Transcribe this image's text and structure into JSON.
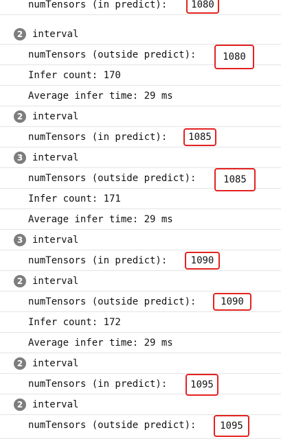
{
  "console": {
    "rows": [
      {
        "type": "msg",
        "prefix": "numTensors (in predict):",
        "value": "1080"
      },
      {
        "type": "group",
        "badge": "2",
        "text": "interval"
      },
      {
        "type": "msg",
        "prefix": "numTensors (outside predict):",
        "value": "1080"
      },
      {
        "type": "msg",
        "text": "Infer count: 170"
      },
      {
        "type": "msg",
        "text": "Average infer time: 29 ms"
      },
      {
        "type": "group",
        "badge": "2",
        "text": "interval"
      },
      {
        "type": "msg",
        "prefix": "numTensors (in predict):",
        "value": "1085"
      },
      {
        "type": "group",
        "badge": "3",
        "text": "interval"
      },
      {
        "type": "msg",
        "prefix": "numTensors (outside predict):",
        "value": "1085"
      },
      {
        "type": "msg",
        "text": "Infer count: 171"
      },
      {
        "type": "msg",
        "text": "Average infer time: 29 ms"
      },
      {
        "type": "group",
        "badge": "3",
        "text": "interval"
      },
      {
        "type": "msg",
        "prefix": "numTensors (in predict):",
        "value": "1090"
      },
      {
        "type": "group",
        "badge": "2",
        "text": "interval"
      },
      {
        "type": "msg",
        "prefix": "numTensors (outside predict):",
        "value": "1090"
      },
      {
        "type": "msg",
        "text": "Infer count: 172"
      },
      {
        "type": "msg",
        "text": "Average infer time: 29 ms"
      },
      {
        "type": "group",
        "badge": "2",
        "text": "interval"
      },
      {
        "type": "msg",
        "prefix": "numTensors (in predict):",
        "value": "1095"
      },
      {
        "type": "group",
        "badge": "2",
        "text": "interval"
      },
      {
        "type": "msg",
        "prefix": "numTensors (outside predict):",
        "value": "1095"
      }
    ]
  },
  "colors": {
    "highlight_border": "#e3211f",
    "badge_background": "#7d7d7d",
    "divider": "#e4e4e4"
  }
}
